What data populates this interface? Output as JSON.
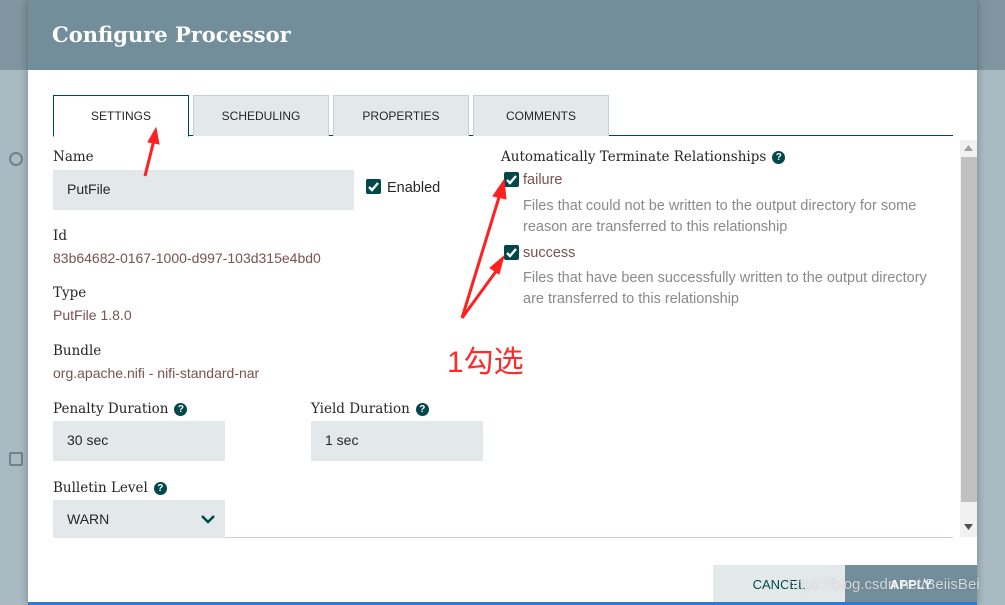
{
  "dialog": {
    "title": "Configure Processor"
  },
  "tabs": [
    {
      "label": "SETTINGS",
      "active": true
    },
    {
      "label": "SCHEDULING"
    },
    {
      "label": "PROPERTIES"
    },
    {
      "label": "COMMENTS"
    }
  ],
  "settings": {
    "name_label": "Name",
    "name_value": "PutFile",
    "enabled_label": "Enabled",
    "enabled": true,
    "id_label": "Id",
    "id_value": "83b64682-0167-1000-d997-103d315e4bd0",
    "type_label": "Type",
    "type_value": "PutFile 1.8.0",
    "bundle_label": "Bundle",
    "bundle_value": "org.apache.nifi - nifi-standard-nar",
    "penalty_label": "Penalty Duration",
    "penalty_value": "30 sec",
    "yield_label": "Yield Duration",
    "yield_value": "1 sec",
    "bulletin_label": "Bulletin Level",
    "bulletin_value": "WARN"
  },
  "relationships": {
    "title": "Automatically Terminate Relationships",
    "items": [
      {
        "name": "failure",
        "checked": true,
        "description": "Files that could not be written to the output directory for some reason are transferred to this relationship"
      },
      {
        "name": "success",
        "checked": true,
        "description": "Files that have been successfully written to the output directory are transferred to this relationship"
      }
    ]
  },
  "footer": {
    "cancel": "CANCEL",
    "apply": "APPLY"
  },
  "annotation": {
    "note": "1勾选",
    "color": "#ff2a2a"
  },
  "watermark": "https://blog.csdn.net/BeiisBei",
  "colors": {
    "header": "#728e9b",
    "accent": "#004849"
  }
}
